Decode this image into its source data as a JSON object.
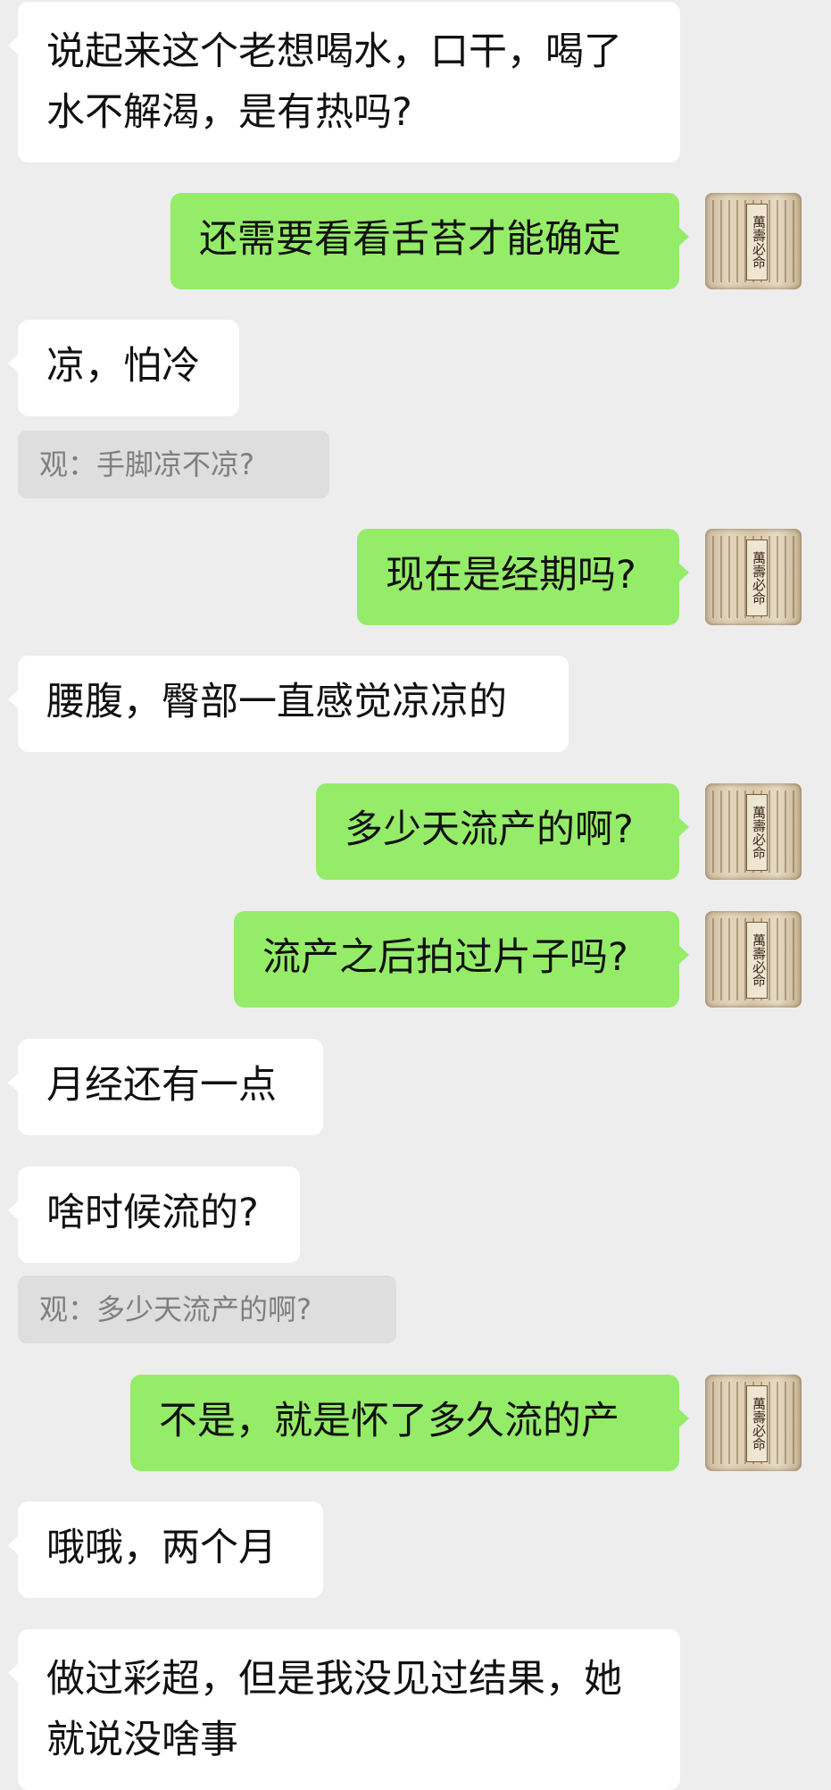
{
  "messages": [
    {
      "side": "left",
      "text": "说起来这个老想喝水，口干，喝了\n水不解渴，是有热吗?"
    },
    {
      "side": "right",
      "text": "还需要看看舌苔才能确定"
    },
    {
      "side": "left",
      "text": "凉，怕冷"
    },
    {
      "side": "quote",
      "text": "观：手脚凉不凉?"
    },
    {
      "side": "right",
      "text": "现在是经期吗?"
    },
    {
      "side": "left",
      "text": "腰腹，臀部一直感觉凉凉的"
    },
    {
      "side": "right",
      "text": "多少天流产的啊?"
    },
    {
      "side": "right",
      "text": "流产之后拍过片子吗?"
    },
    {
      "side": "left",
      "text": "月经还有一点"
    },
    {
      "side": "left",
      "text": "啥时候流的?"
    },
    {
      "side": "quote",
      "text": "观：多少天流产的啊?"
    },
    {
      "side": "right",
      "text": "不是，就是怀了多久流的产"
    },
    {
      "side": "left",
      "text": "哦哦，两个月"
    },
    {
      "side": "left",
      "text": "做过彩超，但是我没见过结果，她\n就说没啥事"
    }
  ],
  "avatar": {
    "icon": "book-cover-avatar-icon",
    "title": "萬壽必命"
  },
  "colors": {
    "background": "#ededed",
    "self_bubble": "#95ec69",
    "other_bubble": "#ffffff",
    "quote_bg": "#dedede"
  }
}
